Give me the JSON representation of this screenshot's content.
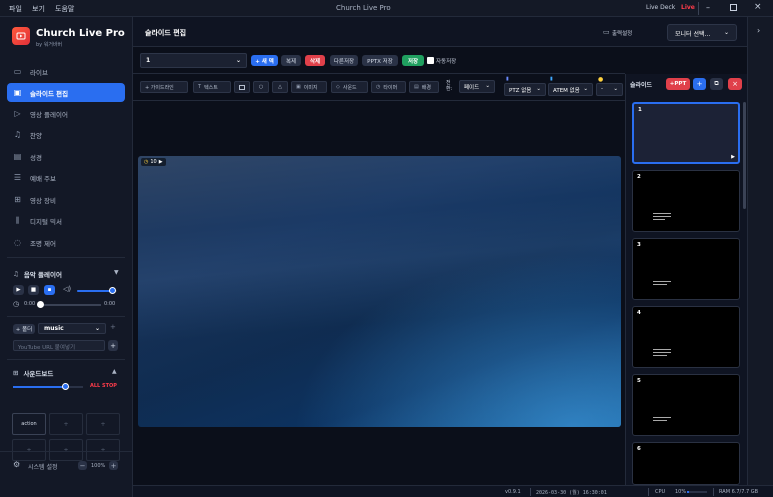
{
  "window": {
    "title": "Church Live Pro",
    "menus": [
      "파일",
      "보기",
      "도움말"
    ],
    "live_deck": "Live Deck",
    "live": "Live"
  },
  "brand": {
    "name": "Church Live Pro",
    "sub": "by 워거바버"
  },
  "sidebar": {
    "items": [
      {
        "label": "라이브",
        "icon": "camera-icon"
      },
      {
        "label": "슬라이드 편집",
        "icon": "monitor-icon"
      },
      {
        "label": "영상 플레이어",
        "icon": "play-icon"
      },
      {
        "label": "찬양",
        "icon": "music-icon"
      },
      {
        "label": "성경",
        "icon": "book-icon"
      },
      {
        "label": "예배 주보",
        "icon": "list-icon"
      },
      {
        "label": "영상 장비",
        "icon": "grid-icon"
      },
      {
        "label": "디지털 믹서",
        "icon": "mixer-icon"
      },
      {
        "label": "조명 제어",
        "icon": "bulb-icon"
      }
    ]
  },
  "music_player": {
    "title": "음악 플레이어",
    "time_start": "0:00",
    "time_end": "0:00",
    "volume": 0.9,
    "add_folder": "+ 폴더",
    "folder_select": "music",
    "youtube_placeholder": "YouTube URL 붙여넣기"
  },
  "soundboard": {
    "title": "사운드보드",
    "all_stop": "ALL STOP",
    "level": 0.75,
    "cells": [
      "action",
      "+",
      "+",
      "+",
      "+",
      "+"
    ]
  },
  "system": {
    "settings": "시스템 설정",
    "zoom": "100%"
  },
  "editor": {
    "title": "슬라이드 편집",
    "output_settings": "출력설정",
    "monitor_select": "모니터 선택...",
    "slide_select": "1",
    "new": "+ 새 덱",
    "duplicate": "복제",
    "delete": "삭제",
    "save_as": "다른저장",
    "pptx_save": "PPTX 저장",
    "save": "저장",
    "autosave": "자동저장",
    "tools": [
      "+ 가이드라인",
      "텍스트",
      "",
      "",
      "",
      "이미지",
      "사운드",
      "타이머",
      "배경"
    ],
    "transition_label": "전환:",
    "transition": "페이드",
    "ptz": "PTZ 없음",
    "atem": "ATEM 없음",
    "extra": "-",
    "canvas_badge": "10"
  },
  "slides_panel": {
    "title": "슬라이드",
    "add_ppt": "+PPT",
    "slides": [
      "1",
      "2",
      "3",
      "4",
      "5",
      "6"
    ]
  },
  "status": {
    "version": "v0.9.1",
    "datetime": "2026-03-30 (월) 16:30:01",
    "cpu_label": "CPU",
    "cpu_value": "10%",
    "cpu_level": 0.1,
    "ram": "RAM 6.7/7.7 GB"
  },
  "colors": {
    "accent": "#2a6ef0",
    "danger": "#e0404a",
    "success": "#20a060",
    "live": "#ff3b4a"
  }
}
